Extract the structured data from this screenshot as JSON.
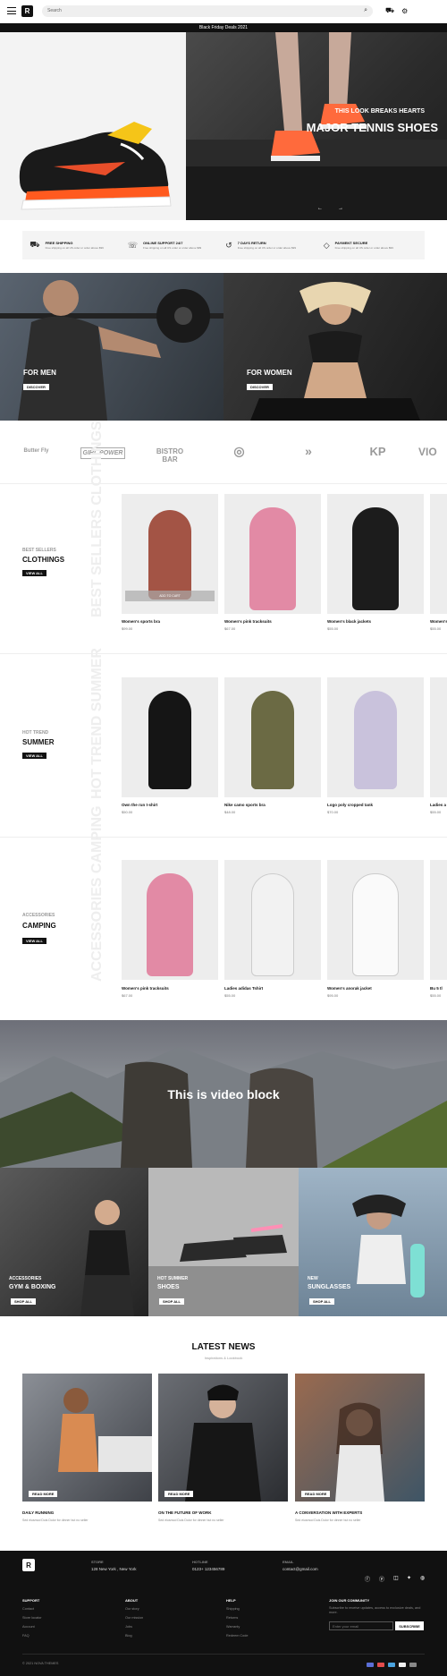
{
  "header": {
    "search_placeholder": "Search",
    "promo": "Black Friday Deals 2021"
  },
  "hero": {
    "subtitle": "THIS LOOK BREAKS HEARTS",
    "title": "MAJOR TENNIS SHOES"
  },
  "features": [
    {
      "icon": "truck-icon",
      "title": "FREE SHIPPING",
      "desc": "Free shipping on all US order or order above $99"
    },
    {
      "icon": "phone-icon",
      "title": "ONLINE SUPPORT 24/7",
      "desc": "Free shipping on all US order or order above $99"
    },
    {
      "icon": "return-icon",
      "title": "7 DAYS RETURN",
      "desc": "Free shipping on all US order or order above $99"
    },
    {
      "icon": "diamond-icon",
      "title": "PAYMENT SECURE",
      "desc": "Free shipping on all US order or order above $99"
    }
  ],
  "banners": [
    {
      "label": "FOR MEN",
      "button": "DISCOVER"
    },
    {
      "label": "FOR WOMEN",
      "button": "DISCOVER"
    }
  ],
  "brands": [
    "Butter Fly",
    "GIRL POWER",
    "BISTRO BAR",
    "",
    "",
    "KP",
    "VIO"
  ],
  "sections": [
    {
      "category": "BEST SELLERS",
      "title": "CLOTHINGS",
      "button": "VIEW ALL",
      "vertical": "BEST SELLERS CLOTHINGS",
      "products": [
        {
          "name": "Women's sports bra",
          "price": "$99.00",
          "quick": "ADD TO CART"
        },
        {
          "name": "Women's pink tracksuits",
          "price": "$67.00"
        },
        {
          "name": "Women's black jackets",
          "price": "$55.00"
        },
        {
          "name": "Women's",
          "price": "$55.00"
        }
      ]
    },
    {
      "category": "HOT TREND",
      "title": "SUMMER",
      "button": "VIEW ALL",
      "vertical": "HOT TREND SUMMER",
      "products": [
        {
          "name": "Own the run t-shirt",
          "price": "$50.00"
        },
        {
          "name": "Nike camo sports bra",
          "price": "$48.00"
        },
        {
          "name": "Logo poly cropped tank",
          "price": "$70.00"
        },
        {
          "name": "Ladies a",
          "price": "$55.00"
        }
      ]
    },
    {
      "category": "ACCESSORIES",
      "title": "CAMPING",
      "button": "VIEW ALL",
      "vertical": "ACCESSORIES CAMPING",
      "products": [
        {
          "name": "Women's pink tracksuits",
          "price": "$67.00"
        },
        {
          "name": "Ladies adidas Tshirt",
          "price": "$55.00"
        },
        {
          "name": "Women's anorak jacket",
          "price": "$95.00"
        },
        {
          "name": "Bu 5 tl",
          "price": "$55.00"
        }
      ]
    }
  ],
  "video": {
    "title": "This is video block"
  },
  "promos": [
    {
      "line1": "ACCESSORIES",
      "line2": "GYM & BOXING",
      "button": "SHOP ALL"
    },
    {
      "line1": "HOT SUMMER",
      "line2": "SHOES",
      "button": "SHOP ALL"
    },
    {
      "line1": "NEW",
      "line2": "SUNGLASSES",
      "button": "SHOP ALL"
    }
  ],
  "news": {
    "title": "LATEST NEWS",
    "subtitle": "Inspirations & Lookbook",
    "items": [
      {
        "title": "DAILY RUNNING",
        "desc": "Sed eiusmod Duis Dolor for dinner but no seller",
        "button": "READ MORE"
      },
      {
        "title": "ON THE FUTURE OF WORK",
        "desc": "Sed eiusmod Duis Dolor for dinner but no seller",
        "button": "READ MORE"
      },
      {
        "title": "A CONVERSATION WITH EXPERTS",
        "desc": "Sed eiusmod Duis Dolor for dinner but no seller",
        "button": "READ MORE"
      }
    ]
  },
  "footer": {
    "store_label": "STORE",
    "store": "128 New York , New York",
    "hotline_label": "HOTLINE",
    "hotline": "0123+ 123456789",
    "email_label": "EMAIL",
    "email": "contact@gmail.com",
    "cols": [
      {
        "title": "SUPPORT",
        "links": [
          "Contact",
          "Store locator",
          "Account",
          "FAQ"
        ]
      },
      {
        "title": "ABOUT",
        "links": [
          "Our story",
          "Our mission",
          "Jobs",
          "Blog"
        ]
      },
      {
        "title": "HELP",
        "links": [
          "Shipping",
          "Returns",
          "Warranty",
          "Redeem Code"
        ]
      }
    ],
    "community": {
      "title": "JOIN OUR COMMUNITY",
      "desc": "Subscribe to receive updates, access to exclusive deals, and more.",
      "placeholder": "Enter your email",
      "button": "SUBSCRIBE"
    },
    "copyright": "© 2021 NOVA THEMES"
  }
}
